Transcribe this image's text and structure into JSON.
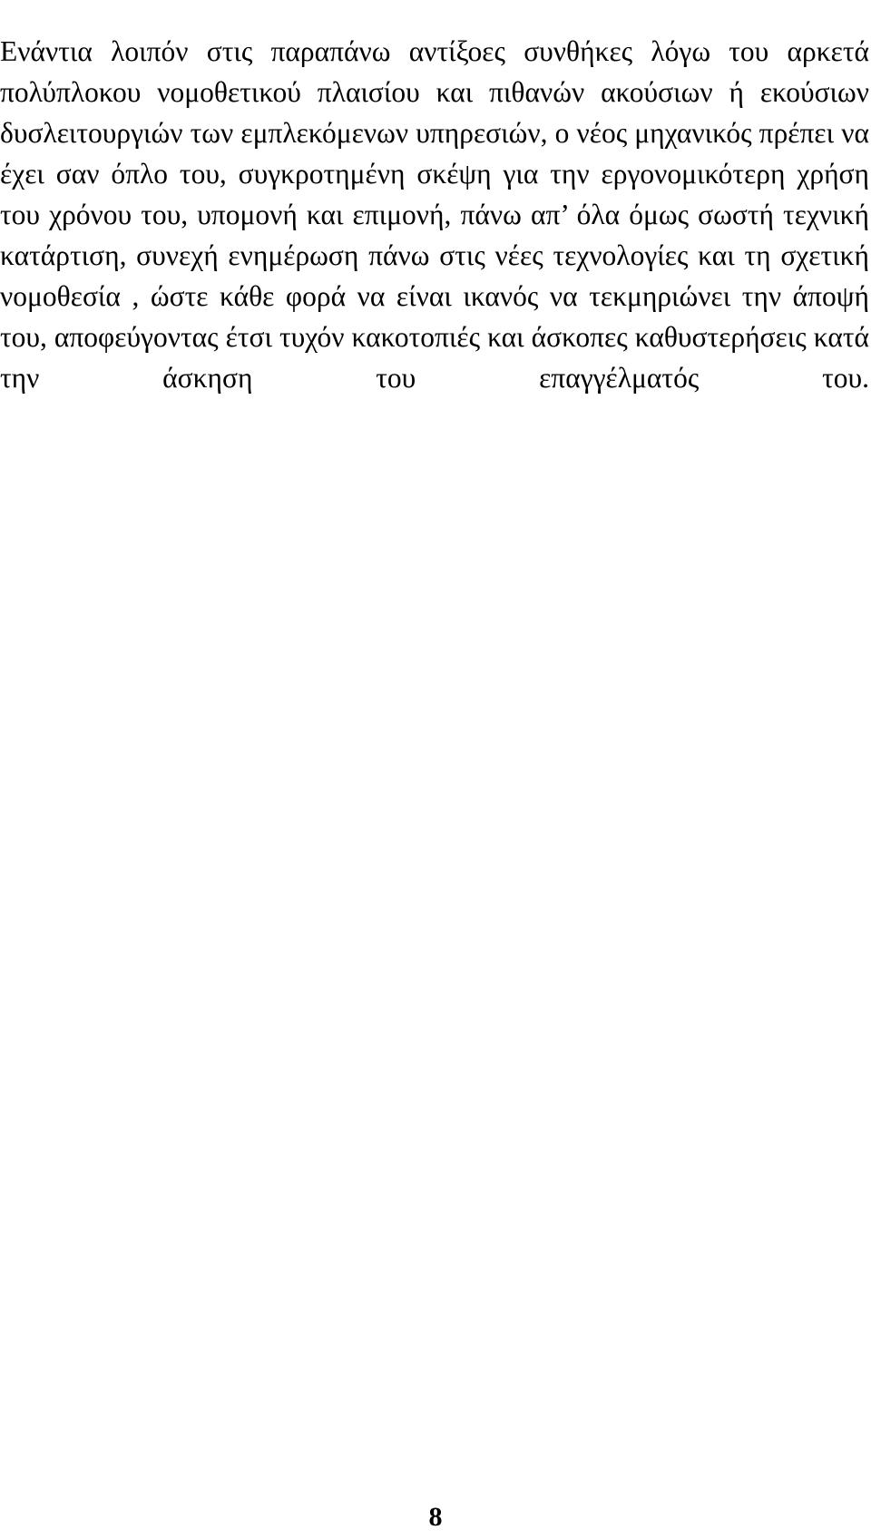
{
  "document": {
    "language": "el",
    "paragraph": "Ενάντια λοιπόν στις παραπάνω αντίξοες συνθήκες λόγω του αρκετά πολύπλοκου νομοθετικού πλαισίου και πιθανών ακούσιων ή εκούσιων δυσλειτουργιών των εμπλεκόμενων υπηρεσιών, ο νέος μηχανικός πρέπει να έχει σαν όπλο του, συγκροτημένη σκέψη για την εργονομικότερη χρήση του χρόνου του, υπομονή και επιμονή, πάνω απ’ όλα όμως σωστή τεχνική κατάρτιση, συνεχή ενημέρωση πάνω στις νέες τεχνολογίες και τη σχετική νομοθεσία , ώστε κάθε φορά να είναι ικανός να τεκμηριώνει την άποψή του, αποφεύγοντας έτσι τυχόν κακοτοπιές και άσκοπες καθυστερήσεις κατά την άσκηση του επαγγέλματός του.",
    "lines": [
      "Ενάντια λοιπόν στις παραπάνω αντίξοες συνθήκες λόγω του αρκετά",
      "πολύπλοκου νομοθετικού πλαισίου και πιθανών ακούσιων ή εκούσιων",
      "δυσλειτουργιών των εμπλεκόμενων υπηρεσιών, ο νέος μηχανικός πρέπει να έχει",
      "σαν όπλο του, συγκροτημένη σκέψη για την εργονομικότερη χρήση του χρόνου",
      "του, υπομονή και επιμονή, πάνω απ’ όλα όμως σωστή τεχνική κατάρτιση,",
      "συνεχή ενημέρωση πάνω στις νέες τεχνολογίες και τη σχετική νομοθεσία , ώστε",
      "κάθε φορά να είναι ικανός να τεκμηριώνει την άποψή του, αποφεύγοντας έτσι",
      "τυχόν κακοτοπιές και άσκοπες καθυστερήσεις κατά την άσκηση του",
      "επαγγέλματός του."
    ],
    "page_number": "8"
  }
}
